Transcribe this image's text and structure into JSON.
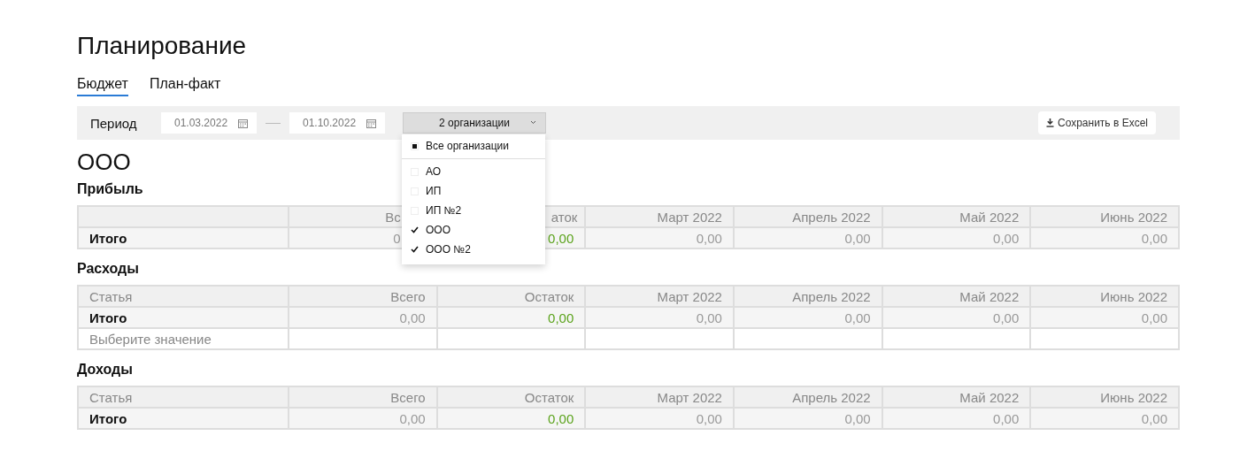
{
  "title": "Планирование",
  "tabs": [
    {
      "label": "Бюджет",
      "selected": true
    },
    {
      "label": "План-факт",
      "selected": false
    }
  ],
  "filter": {
    "label": "Период",
    "date_from": "01.03.2022",
    "date_to": "01.10.2022",
    "org_select": "2 организации",
    "save_button": "Сохранить в Excel"
  },
  "org_menu": {
    "all": {
      "label": "Все организации",
      "indeterminate": true
    },
    "items": [
      {
        "label": "АО",
        "checked": false
      },
      {
        "label": "ИП",
        "checked": false
      },
      {
        "label": "ИП №2",
        "checked": false
      },
      {
        "label": "ООО",
        "checked": true
      },
      {
        "label": "ООО №2",
        "checked": true
      }
    ]
  },
  "organization": "ООО",
  "sections": [
    {
      "title": "Прибыль",
      "columns": [
        "",
        "Вс",
        "аток",
        "Март 2022",
        "Апрель 2022",
        "Май 2022",
        "Июнь 2022"
      ],
      "rows": [
        {
          "kind": "total",
          "cells": [
            "Итого",
            "0",
            {
              "text": "0,00",
              "color": "#5ba31c"
            },
            "0,00",
            "0,00",
            "0,00",
            "0,00"
          ]
        }
      ]
    },
    {
      "title": "Расходы",
      "columns": [
        "Статья",
        "Всего",
        "Остаток",
        "Март 2022",
        "Апрель 2022",
        "Май 2022",
        "Июнь 2022"
      ],
      "rows": [
        {
          "kind": "total",
          "cells": [
            "Итого",
            "0,00",
            {
              "text": "0,00",
              "color": "#5ba31c"
            },
            "0,00",
            "0,00",
            "0,00",
            "0,00"
          ]
        },
        {
          "kind": "placeholder",
          "cells": [
            "Выберите значение",
            "",
            "",
            "",
            "",
            "",
            ""
          ]
        }
      ]
    },
    {
      "title": "Доходы",
      "columns": [
        "Статья",
        "Всего",
        "Остаток",
        "Март 2022",
        "Апрель 2022",
        "Май 2022",
        "Июнь 2022"
      ],
      "rows": [
        {
          "kind": "total",
          "cells": [
            "Итого",
            "0,00",
            {
              "text": "0,00",
              "color": "#5ba31c"
            },
            "0,00",
            "0,00",
            "0,00",
            "0,00"
          ]
        }
      ]
    }
  ]
}
